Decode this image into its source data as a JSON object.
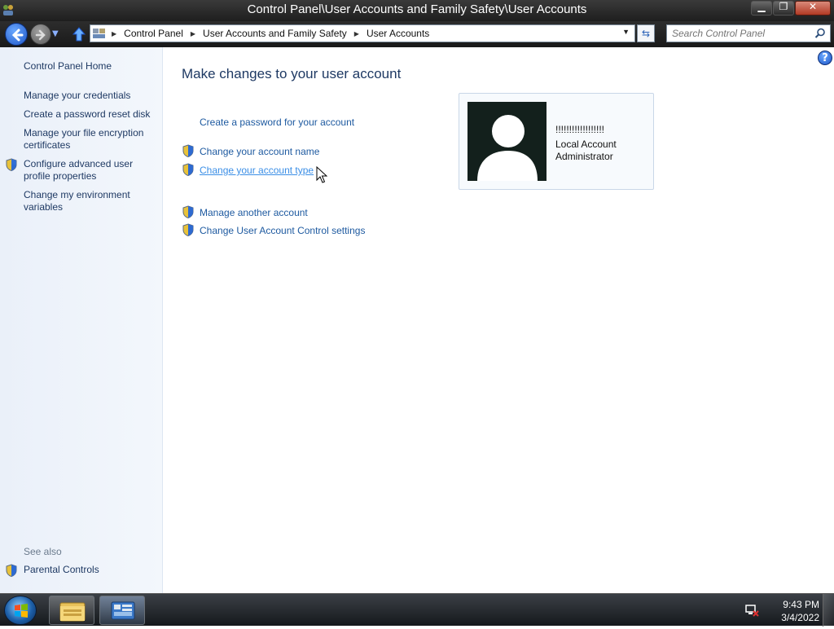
{
  "window": {
    "title": "Control Panel\\User Accounts and Family Safety\\User Accounts",
    "minimize_icon": "minimize-icon",
    "maximize_icon": "restore-icon",
    "close_icon": "close-icon"
  },
  "address_bar": {
    "breadcrumbs": [
      "Control Panel",
      "User Accounts and Family Safety",
      "User Accounts"
    ],
    "search_placeholder": "Search Control Panel"
  },
  "sidebar": {
    "home": "Control Panel Home",
    "links": [
      "Manage your credentials",
      "Create a password reset disk",
      "Manage your file encryption certificates",
      "Configure advanced user profile properties",
      "Change my environment variables"
    ],
    "see_also_label": "See also",
    "see_also_links": [
      "Parental Controls"
    ]
  },
  "main": {
    "heading": "Make changes to your user account",
    "tasks": [
      "Create a password for your account",
      "Change your account name",
      "Change your account type",
      "Manage another account",
      "Change User Account Control settings"
    ],
    "account": {
      "name": "!!!!!!!!!!!!!!!!!!",
      "type": "Local Account Administrator"
    }
  },
  "taskbar": {
    "time": "9:43 PM",
    "date": "3/4/2022"
  },
  "colors": {
    "link": "#1e5aa0",
    "heading": "#1e3963",
    "sidebar_bg": "#eaf0f9"
  }
}
